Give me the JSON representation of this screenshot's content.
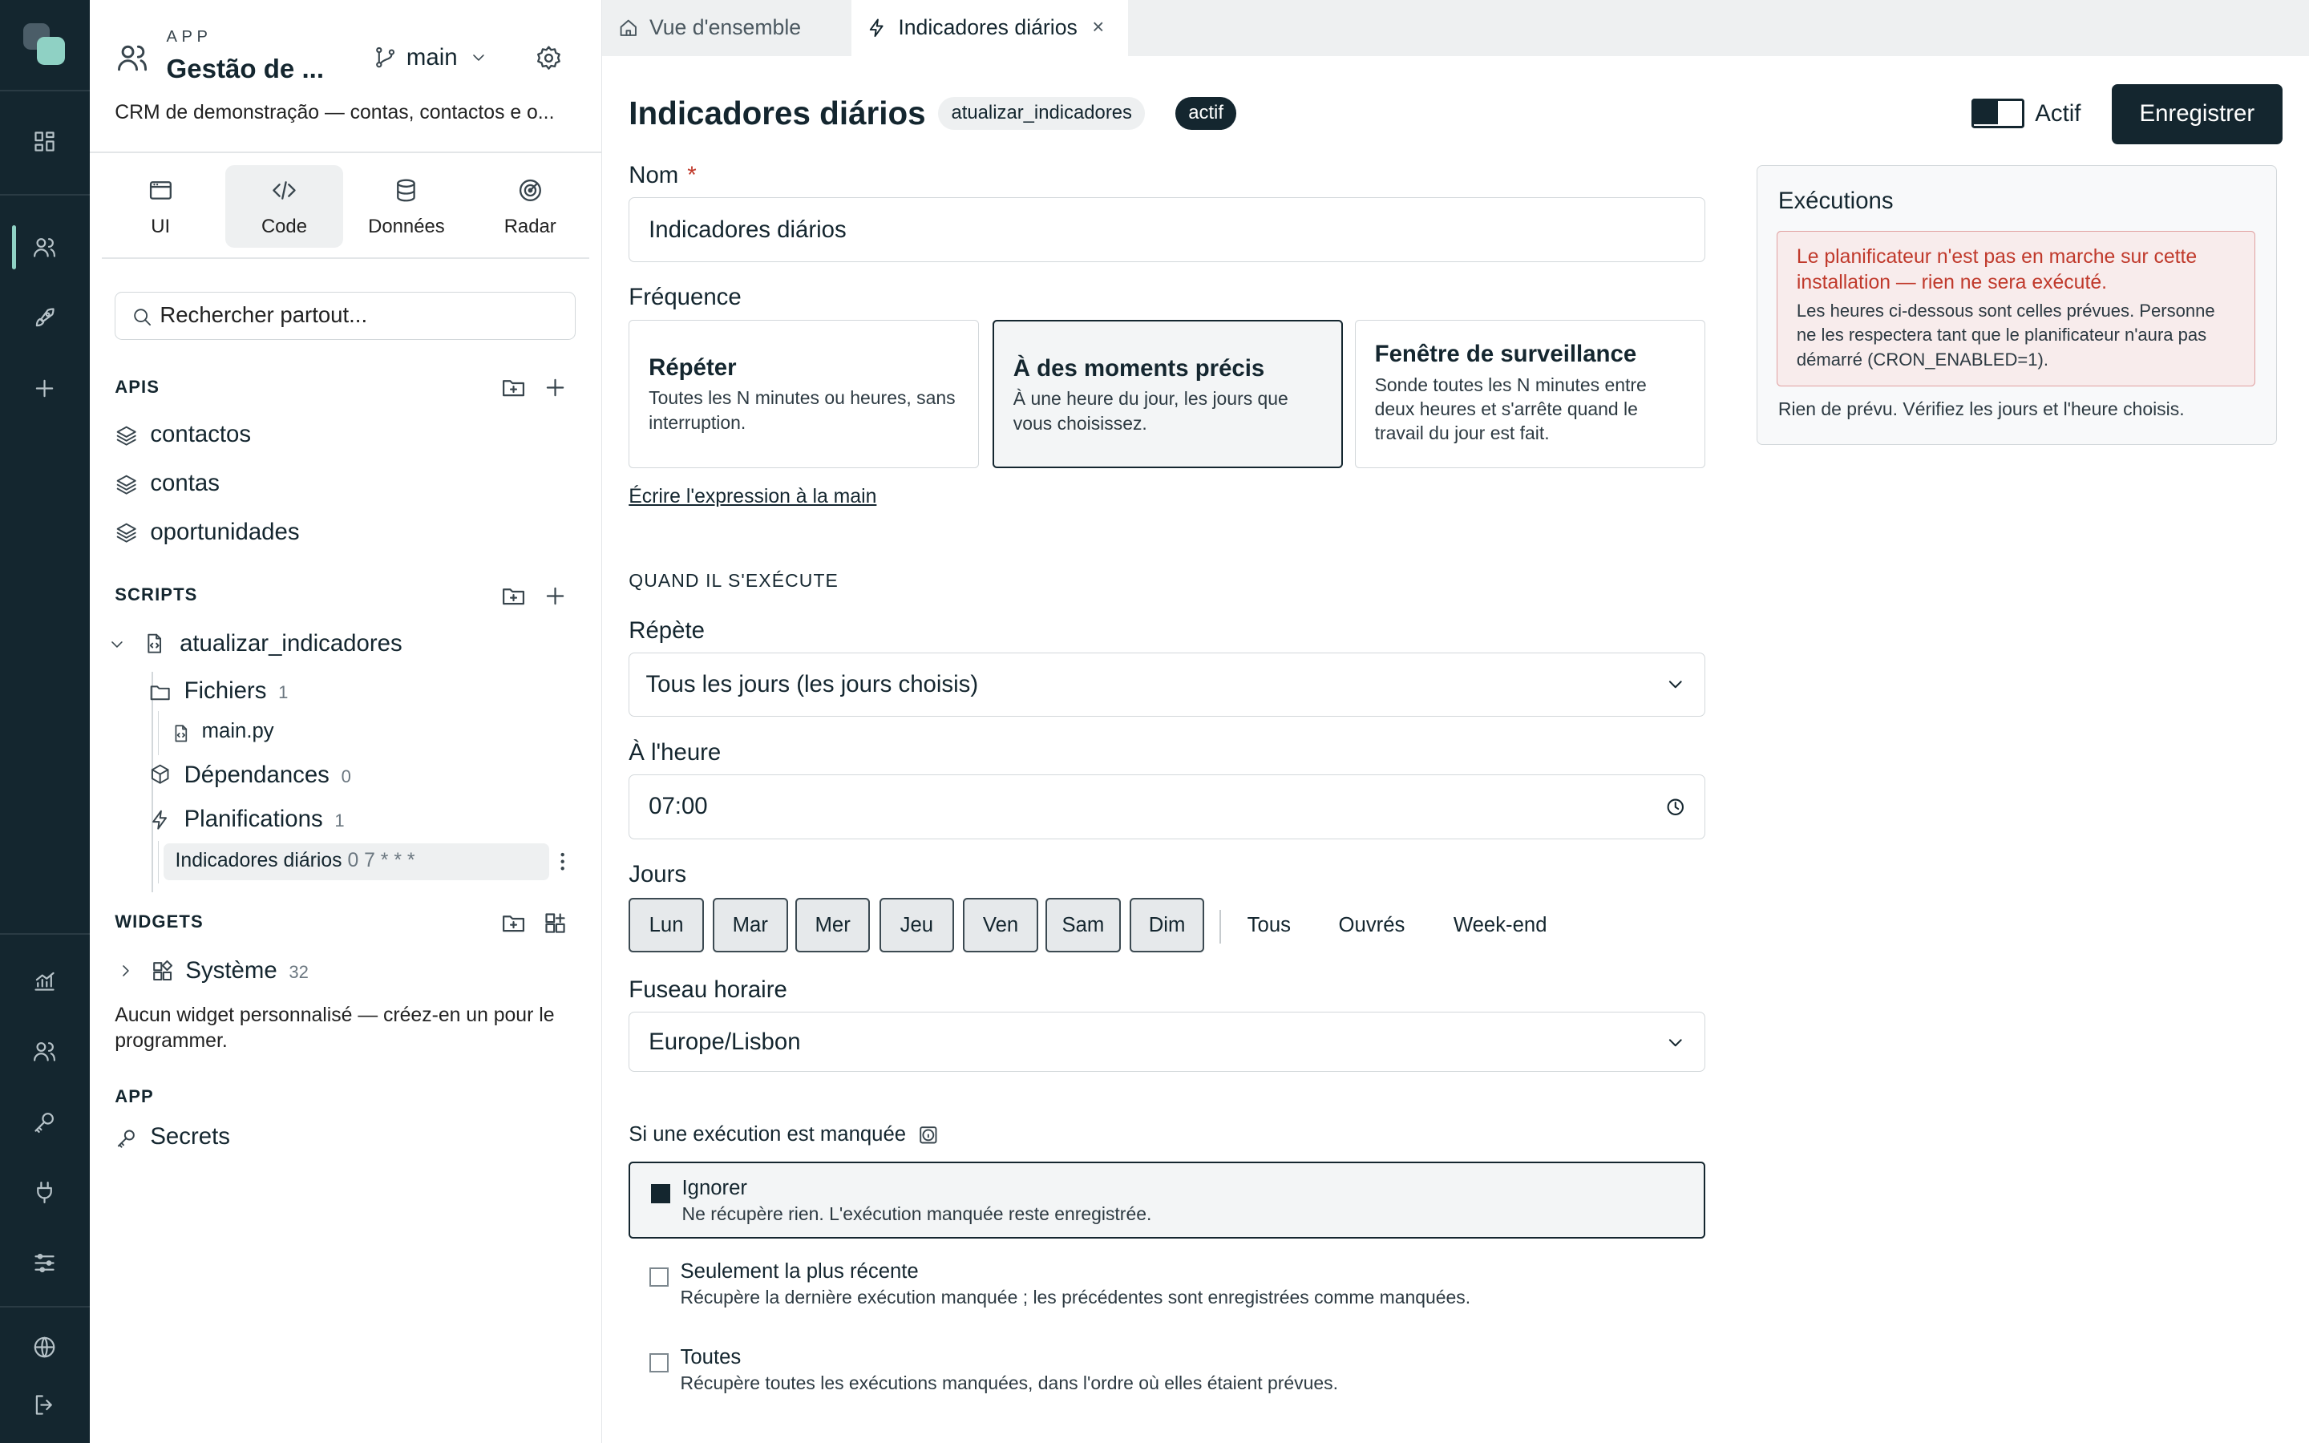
{
  "rail": {
    "icons": [
      "dashboard-icon",
      "users-icon",
      "rocket-icon",
      "plus-icon",
      "chart-icon",
      "people-icon",
      "key-icon",
      "plug-icon",
      "sliders-icon",
      "globe-icon",
      "logout-icon"
    ]
  },
  "app": {
    "kicker": "APP",
    "title": "Gestão de ...",
    "branch": "main",
    "description": "CRM de demonstração — contas, contactos e o..."
  },
  "modes": [
    {
      "label": "UI"
    },
    {
      "label": "Code"
    },
    {
      "label": "Données"
    },
    {
      "label": "Radar"
    }
  ],
  "search": {
    "placeholder": "Rechercher partout..."
  },
  "sections": {
    "apis": "APIS",
    "scripts": "SCRIPTS",
    "widgets": "WIDGETS",
    "app": "APP"
  },
  "apis": [
    "contactos",
    "contas",
    "oportunidades"
  ],
  "script": {
    "name": "atualizar_indicadores",
    "files_label": "Fichiers",
    "files_count": "1",
    "file": "main.py",
    "deps_label": "Dépendances",
    "deps_count": "0",
    "sched_label": "Planifications",
    "sched_count": "1",
    "sched_item": "Indicadores diários",
    "sched_cron": "0 7 * * *"
  },
  "widgets": {
    "system_label": "Système",
    "system_count": "32",
    "empty": "Aucun widget personnalisé — créez-en un pour le programmer."
  },
  "app_section": {
    "secrets": "Secrets"
  },
  "tabs": [
    {
      "label": "Vue d'ensemble"
    },
    {
      "label": "Indicadores diários",
      "close": "×"
    }
  ],
  "header": {
    "title": "Indicadores diários",
    "script_badge": "atualizar_indicadores",
    "status_badge": "actif",
    "toggle_label": "Actif",
    "save": "Enregistrer"
  },
  "form": {
    "name_label": "Nom",
    "name_required": "*",
    "name_value": "Indicadores diários",
    "freq_label": "Fréquence",
    "freq_options": [
      {
        "title": "Répéter",
        "desc": "Toutes les N minutes ou heures, sans interruption."
      },
      {
        "title": "À des moments précis",
        "desc": "À une heure du jour, les jours que vous choisissez."
      },
      {
        "title": "Fenêtre de surveillance",
        "desc": "Sonde toutes les N minutes entre deux heures et s'arrête quand le travail du jour est fait."
      }
    ],
    "manual_link": "Écrire l'expression à la main",
    "when_heading": "QUAND IL S'EXÉCUTE",
    "repeat_label": "Répète",
    "repeat_value": "Tous les jours (les jours choisis)",
    "time_label": "À l'heure",
    "time_value": "07:00",
    "days_label": "Jours",
    "days": [
      "Lun",
      "Mar",
      "Mer",
      "Jeu",
      "Ven",
      "Sam",
      "Dim"
    ],
    "quick": [
      "Tous",
      "Ouvrés",
      "Week-end"
    ],
    "tz_label": "Fuseau horaire",
    "tz_value": "Europe/Lisbon",
    "missed_label": "Si une exécution est manquée",
    "missed_options": [
      {
        "title": "Ignorer",
        "desc": "Ne récupère rien. L'exécution manquée reste enregistrée."
      },
      {
        "title": "Seulement la plus récente",
        "desc": "Récupère la dernière exécution manquée ; les précédentes sont enregistrées comme manquées."
      },
      {
        "title": "Toutes",
        "desc": "Récupère toutes les exécutions manquées, dans l'ordre où elles étaient prévues."
      }
    ]
  },
  "executions": {
    "title": "Exécutions",
    "alert_title": "Le planificateur n'est pas en marche sur cette installation — rien ne sera exécuté.",
    "alert_desc": "Les heures ci-dessous sont celles prévues. Personne ne les respectera tant que le planificateur n'aura pas démarré (CRON_ENABLED=1).",
    "none": "Rien de prévu. Vérifiez les jours et l'heure choisis."
  },
  "colors": {
    "rail": "#14262f",
    "accent": "#8fd1c4",
    "primary": "#14262f",
    "danger": "#c0392b"
  }
}
